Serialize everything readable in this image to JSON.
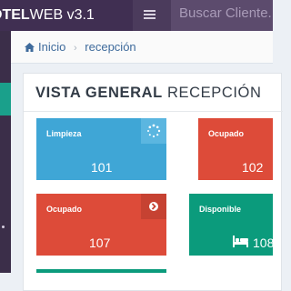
{
  "header": {
    "brand_bold": "OTEL",
    "brand_rest": "WEB v3.1",
    "search_placeholder": "Buscar Cliente..."
  },
  "breadcrumb": {
    "home": "Inicio",
    "current": "recepción"
  },
  "panel": {
    "title_bold": "VISTA GENERAL",
    "title_rest": " RECEPCIÓN"
  },
  "cards": [
    {
      "label": "Limpieza",
      "value": "101",
      "icon": "spinner-icon",
      "color": "#3fa6d6"
    },
    {
      "label": "Ocupado",
      "value": "102",
      "color": "#dd4b39"
    },
    {
      "label": "Ocupado",
      "value": "107",
      "icon": "arrow-circle-right-icon",
      "color": "#dd4b39"
    },
    {
      "label": "Disponible",
      "value": "108",
      "icon": "bed-icon",
      "color": "#0b9b7c"
    }
  ],
  "colors": {
    "topbar": "#4b3b5c",
    "sidebar": "#3b2e49",
    "sidebar_active": "#1aa08b",
    "link": "#3f6b9c"
  }
}
